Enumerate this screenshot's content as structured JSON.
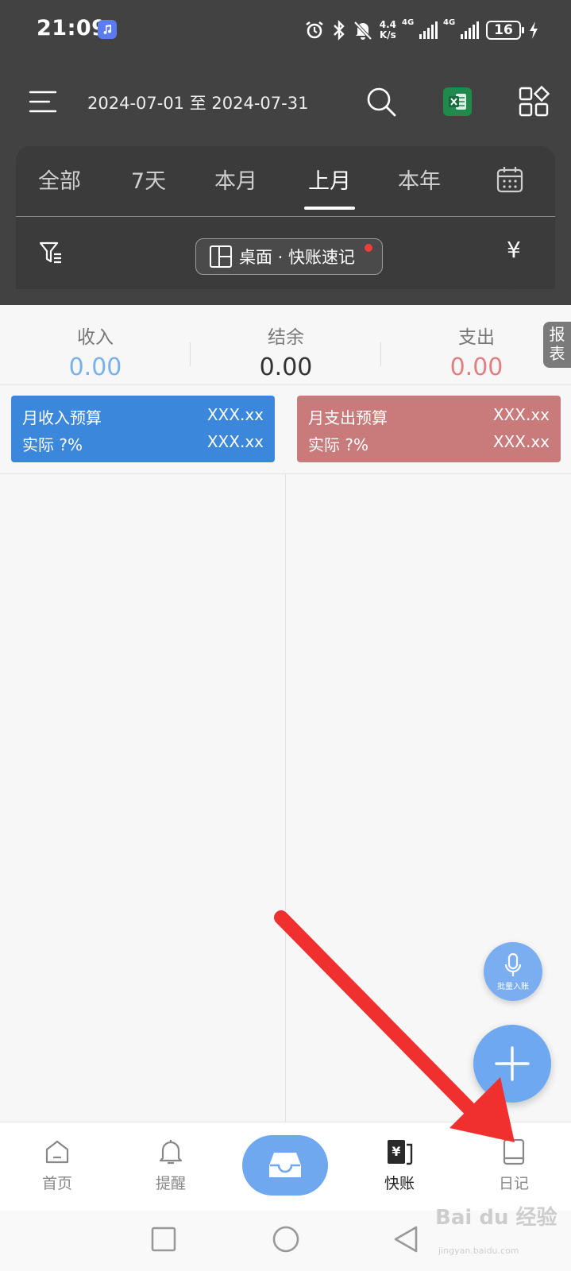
{
  "status_bar": {
    "time": "21:09",
    "speed_top": "4.4",
    "speed_bottom": "K/s",
    "signal1_label": "4G",
    "signal2_label": "4G",
    "battery": "16"
  },
  "toolbar": {
    "date_range": "2024-07-01 至 2024-07-31"
  },
  "tabs": [
    {
      "label": "全部"
    },
    {
      "label": "7天"
    },
    {
      "label": "本月"
    },
    {
      "label": "上月",
      "active": true
    },
    {
      "label": "本年"
    }
  ],
  "filter_row": {
    "desk_chip_label": "桌面 · 快账速记",
    "currency_symbol": "¥"
  },
  "summary": {
    "income_label": "收入",
    "income_value": "0.00",
    "balance_label": "结余",
    "balance_value": "0.00",
    "expense_label": "支出",
    "expense_value": "0.00",
    "report_tab": "报表"
  },
  "budget": {
    "income": {
      "title": "月收入预算",
      "title_value": "XXX.xx",
      "actual": "实际 ?%",
      "actual_value": "XXX.xx"
    },
    "expense": {
      "title": "月支出预算",
      "title_value": "XXX.xx",
      "actual": "实际 ?%",
      "actual_value": "XXX.xx"
    }
  },
  "fab": {
    "mic_label": "批量入账"
  },
  "bottom_nav": [
    {
      "label": "首页",
      "icon": "home-icon"
    },
    {
      "label": "提醒",
      "icon": "bell-icon"
    },
    {
      "label": "",
      "icon": "inbox-icon"
    },
    {
      "label": "快账",
      "icon": "ledger-icon",
      "active": true
    },
    {
      "label": "日记",
      "icon": "diary-icon"
    }
  ],
  "watermark": {
    "text": "Bai du 经验",
    "sub": "jingyan.baidu.com"
  },
  "colors": {
    "header": "#424242",
    "income": "#3a87dc",
    "expense": "#c97a7a",
    "accent": "#6ea8f0",
    "arrow": "#f0302e"
  }
}
